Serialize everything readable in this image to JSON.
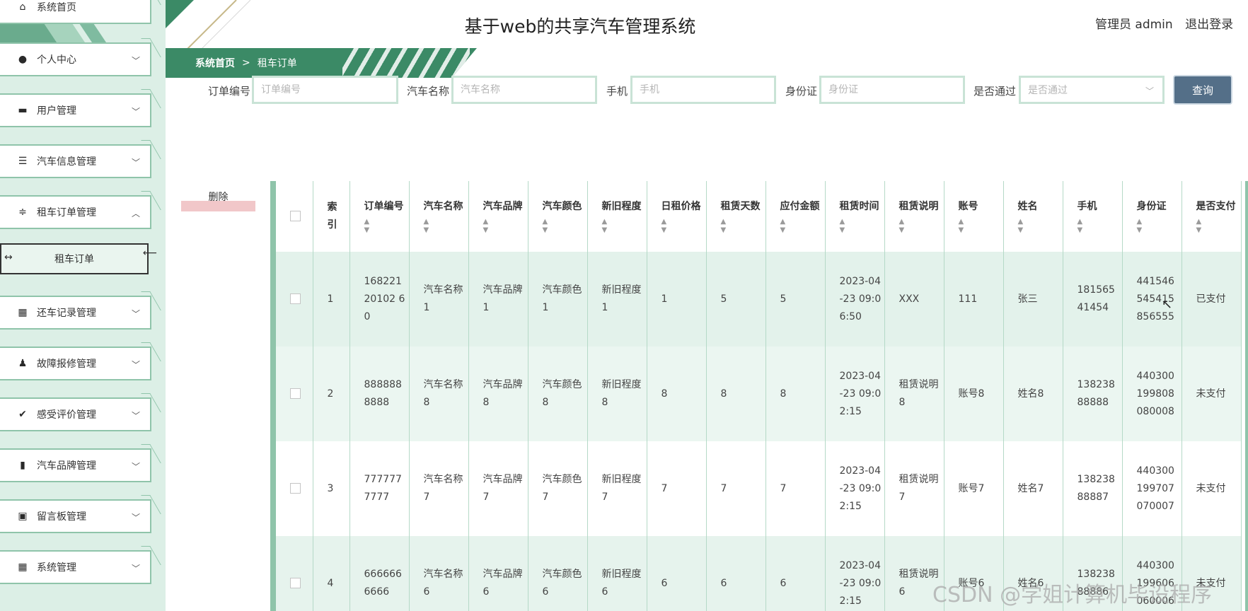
{
  "app": {
    "title": "基于web的共享汽车管理系统",
    "user_label": "管理员 admin",
    "logout_label": "退出登录"
  },
  "breadcrumb": {
    "home": "系统首页",
    "separator": ">",
    "current": "租车订单"
  },
  "sidebar": {
    "items": [
      {
        "label": "系统首页",
        "icon": "home-icon"
      },
      {
        "label": "个人中心",
        "icon": "user-icon"
      },
      {
        "label": "用户管理",
        "icon": "monitor-icon"
      },
      {
        "label": "汽车信息管理",
        "icon": "list-icon"
      },
      {
        "label": "租车订单管理",
        "icon": "sliders-icon"
      },
      {
        "label": "还车记录管理",
        "icon": "grid-icon"
      },
      {
        "label": "故障报修管理",
        "icon": "person-stamp-icon"
      },
      {
        "label": "感受评价管理",
        "icon": "clipboard-check-icon"
      },
      {
        "label": "汽车品牌管理",
        "icon": "book-icon"
      },
      {
        "label": "留言板管理",
        "icon": "store-icon"
      },
      {
        "label": "系统管理",
        "icon": "grid-icon"
      }
    ],
    "sub_active": "租车订单"
  },
  "search": {
    "order_no_label": "订单编号",
    "order_no_placeholder": "订单编号",
    "car_name_label": "汽车名称",
    "car_name_placeholder": "汽车名称",
    "phone_label": "手机",
    "phone_placeholder": "手机",
    "id_card_label": "身份证",
    "id_card_placeholder": "身份证",
    "approved_label": "是否通过",
    "approved_placeholder": "是否通过",
    "query_label": "查询"
  },
  "actions": {
    "delete_label": "删除"
  },
  "table": {
    "columns": [
      "索引",
      "订单编号",
      "汽车名称",
      "汽车品牌",
      "汽车颜色",
      "新旧程度",
      "日租价格",
      "租赁天数",
      "应付金额",
      "租赁时间",
      "租赁说明",
      "账号",
      "姓名",
      "手机",
      "身份证",
      "是否支付"
    ],
    "rows": [
      [
        "1",
        "16822120102 60",
        "汽车名称1",
        "汽车品牌1",
        "汽车颜色1",
        "新旧程度1",
        "1",
        "5",
        "5",
        "2023-04-23 09:06:50",
        "XXX",
        "111",
        "张三",
        "18156541454",
        "441546545415856555",
        "已支付"
      ],
      [
        "2",
        "8888888888",
        "汽车名称8",
        "汽车品牌8",
        "汽车颜色8",
        "新旧程度8",
        "8",
        "8",
        "8",
        "2023-04-23 09:02:15",
        "租赁说明8",
        "账号8",
        "姓名8",
        "13823888888",
        "440300199808080008",
        "未支付"
      ],
      [
        "3",
        "7777777777",
        "汽车名称7",
        "汽车品牌7",
        "汽车颜色7",
        "新旧程度7",
        "7",
        "7",
        "7",
        "2023-04-23 09:02:15",
        "租赁说明7",
        "账号7",
        "姓名7",
        "13823888887",
        "440300199707070007",
        "未支付"
      ],
      [
        "4",
        "6666666666",
        "汽车名称6",
        "汽车品牌6",
        "汽车颜色6",
        "新旧程度6",
        "6",
        "6",
        "6",
        "2023-04-23 09:02:15",
        "租赁说明6",
        "账号6",
        "姓名6",
        "13823888886",
        "440300199606060006",
        "未支付"
      ]
    ]
  },
  "watermark": "CSDN @学姐计算机毕设程序",
  "colors": {
    "accent": "#3b8a66",
    "sidebar_bg": "#dcefe6",
    "query_button": "#546f88"
  }
}
